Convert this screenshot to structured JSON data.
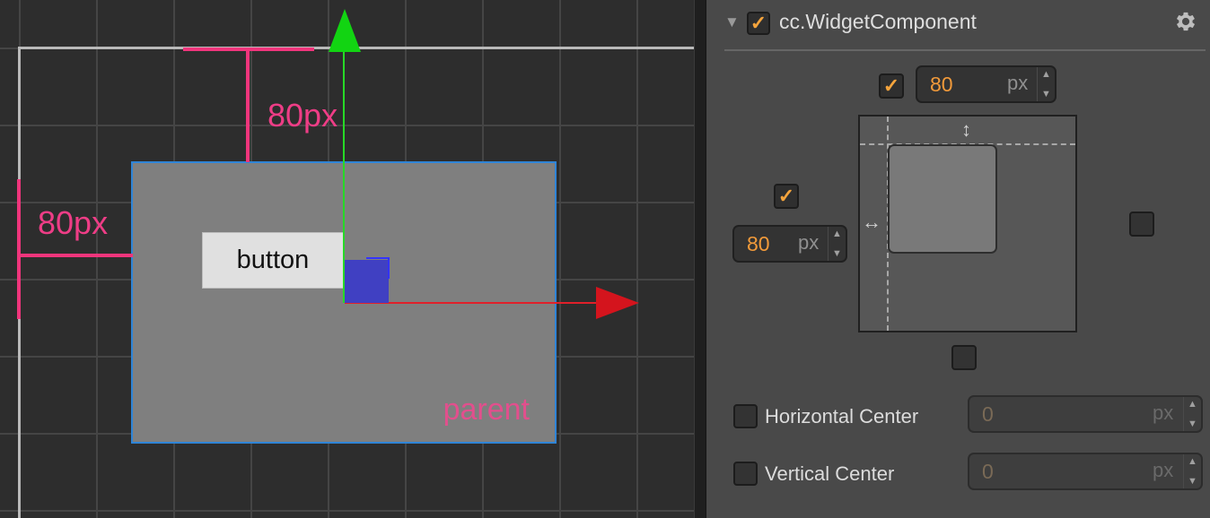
{
  "scene": {
    "top_margin_label": "80px",
    "left_margin_label": "80px",
    "button_text": "button",
    "parent_text": "parent",
    "colors": {
      "margin_marker": "#f0357c",
      "parent_border": "#2f84d6",
      "y_axis": "#12d412",
      "x_axis": "#d4141d"
    }
  },
  "inspector": {
    "component_title": "cc.WidgetComponent",
    "component_enabled": true,
    "gear_icon": "gear-icon",
    "top": {
      "enabled": true,
      "value": "80",
      "unit": "px"
    },
    "left": {
      "enabled": true,
      "value": "80",
      "unit": "px"
    },
    "right": {
      "enabled": false
    },
    "bottom": {
      "enabled": false
    },
    "horizontal_center": {
      "label": "Horizontal Center",
      "enabled": false,
      "value": "0",
      "unit": "px"
    },
    "vertical_center": {
      "label": "Vertical Center",
      "enabled": false,
      "value": "0",
      "unit": "px"
    },
    "accent_color": "#f5a43c"
  }
}
